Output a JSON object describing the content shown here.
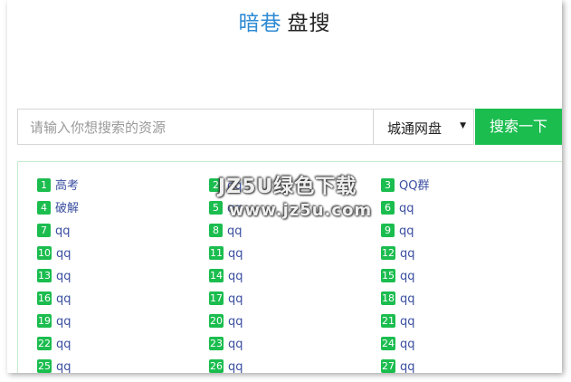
{
  "logo": {
    "part1": "暗巷",
    "part2": "盘搜"
  },
  "search": {
    "placeholder": "请输入你想搜索的资源",
    "value": "",
    "source_selected": "城通网盘",
    "button_label": "搜索一下"
  },
  "hot_list": [
    {
      "num": "1",
      "label": "高考"
    },
    {
      "num": "2",
      "label": "qq"
    },
    {
      "num": "3",
      "label": "QQ群"
    },
    {
      "num": "4",
      "label": "破解"
    },
    {
      "num": "5",
      "label": "qq"
    },
    {
      "num": "6",
      "label": "qq"
    },
    {
      "num": "7",
      "label": "qq"
    },
    {
      "num": "8",
      "label": "qq"
    },
    {
      "num": "9",
      "label": "qq"
    },
    {
      "num": "10",
      "label": "qq"
    },
    {
      "num": "11",
      "label": "qq"
    },
    {
      "num": "12",
      "label": "qq"
    },
    {
      "num": "13",
      "label": "qq"
    },
    {
      "num": "14",
      "label": "qq"
    },
    {
      "num": "15",
      "label": "qq"
    },
    {
      "num": "16",
      "label": "qq"
    },
    {
      "num": "17",
      "label": "qq"
    },
    {
      "num": "18",
      "label": "qq"
    },
    {
      "num": "19",
      "label": "qq"
    },
    {
      "num": "20",
      "label": "qq"
    },
    {
      "num": "21",
      "label": "qq"
    },
    {
      "num": "22",
      "label": "qq"
    },
    {
      "num": "23",
      "label": "qq"
    },
    {
      "num": "24",
      "label": "qq"
    },
    {
      "num": "25",
      "label": "qq"
    },
    {
      "num": "26",
      "label": "qq"
    },
    {
      "num": "27",
      "label": "qq"
    }
  ],
  "watermark": {
    "line1": "JZ5U绿色下载",
    "line2": "www.jz5u.com"
  },
  "colors": {
    "accent_green": "#1bbd4f",
    "logo_blue": "#2d8ad3",
    "link_blue": "#3b4fa0",
    "panel_border": "#c6eccb"
  }
}
